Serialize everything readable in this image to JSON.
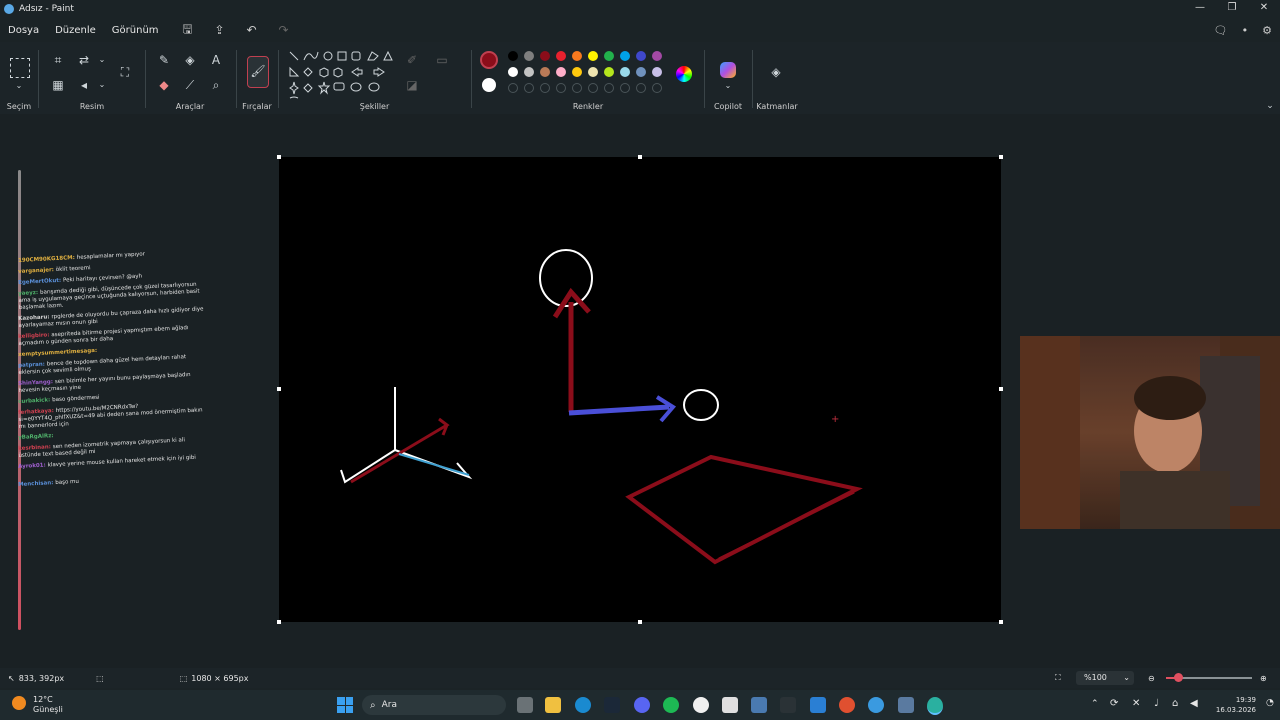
{
  "title": "Adsız - Paint",
  "window_controls": {
    "minimize": "—",
    "restore": "❐",
    "close": "✕"
  },
  "menu": {
    "file": "Dosya",
    "edit": "Düzenle",
    "view": "Görünüm"
  },
  "ribbon": {
    "selection": "Seçim",
    "image": "Resim",
    "tools": "Araçlar",
    "brushes": "Fırçalar",
    "shapes": "Şekiller",
    "colors": "Renkler",
    "copilot": "Copilot",
    "layers": "Katmanlar"
  },
  "palette": {
    "primary": "#8b0d1a",
    "secondary": "#ffffff",
    "row1": [
      "#000000",
      "#7f7f7f",
      "#8b0d1a",
      "#e8212e",
      "#f7791e",
      "#fff200",
      "#22b14c",
      "#00a2e8",
      "#3f48cc",
      "#a349a4"
    ],
    "row2": [
      "#ffffff",
      "#c3c3c3",
      "#b97a57",
      "#ffaec9",
      "#ffc90e",
      "#efe4b0",
      "#b5e61d",
      "#99d9ea",
      "#7092be",
      "#c8bfe7"
    ]
  },
  "chat": {
    "messages": [
      {
        "user": "190CM90KG18CM:",
        "text": "hesaplamalar mı yapıyor",
        "color": "#e0b040"
      },
      {
        "user": "varganajer:",
        "text": "öklit teoremi",
        "color": "#e0b040"
      },
      {
        "user": "EgeMertOkut:",
        "text": "Peki haritayı çevirsen? @ayh",
        "color": "#5a8fd8"
      },
      {
        "user": "yaeyz:",
        "text": "barışımda dediği gibi, düşüncede çok güzel tasarlıyorsun ama iş uygulamaya geçince uçtuğunda kalıyorsun, harbiden basit başlamak lazım.",
        "color": "#4fb06a"
      },
      {
        "user": "Kazoharu:",
        "text": "rpglerde de oluyordu bu çapraza daha hızlı gidiyor diye ayarlayamaz mısın onun gibi",
        "color": "#d8d8d8"
      },
      {
        "user": "kelligbiro:",
        "text": "asepriteda bitirme projesi yapmıştım ebem ağladı açmadım o günden sonra bir daha",
        "color": "#d04050"
      },
      {
        "user": "xemptysummertimesaga:",
        "text": "",
        "color": "#e0b040"
      },
      {
        "user": "patpran:",
        "text": "bence de topdown daha güzel hem detayları rahat eklersin çok sevimli olmuş",
        "color": "#5a8fd8"
      },
      {
        "user": "ShinYangg:",
        "text": "sen bizimle her yayını bunu paylaşmaya başladın hevesin keçmasın yine",
        "color": "#a060d0"
      },
      {
        "user": "curbakick:",
        "text": "baso göndermesi",
        "color": "#4fb06a"
      },
      {
        "user": "ferhatkaya:",
        "text": "https://youtu.be/M2CNRdxTw?si=e0YYT4Q_phIfXUZ&t=49 abi deden sana mod önermiştim bakın mı bannerlord için",
        "color": "#d04050"
      },
      {
        "user": "yBaRgAlRz:",
        "text": "",
        "color": "#4fb06a"
      },
      {
        "user": "kesrbinan:",
        "text": "sen neden izometrik yapmaya çalışıyorsun ki ali üstünde text based değil mi",
        "color": "#d04050"
      },
      {
        "user": "Ayrok01:",
        "text": "klavye yerine mouse kullan hareket etmek için iyi gibi",
        "color": "#a060d0"
      },
      {
        "user": "Menchisan:",
        "text": "başo mu",
        "color": "#5a8fd8"
      }
    ]
  },
  "status": {
    "cursor_pos": "833, 392px",
    "canvas_size": "1080 × 695px",
    "zoom": "%100"
  },
  "taskbar": {
    "weather_temp": "12°C",
    "weather_desc": "Güneşli",
    "search": "Ara",
    "time": "19:39",
    "date": "16.03.2026"
  }
}
